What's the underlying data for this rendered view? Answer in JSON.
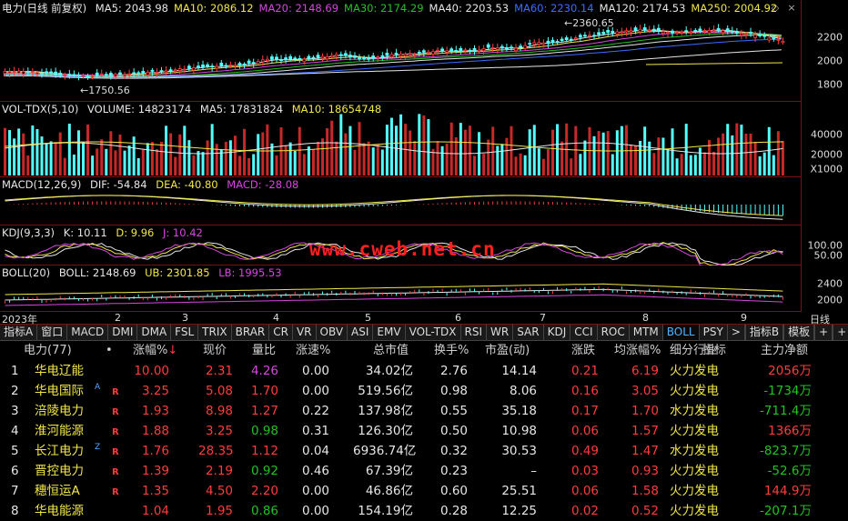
{
  "main_chart": {
    "title": "电力(日线 前复权)",
    "indicators": [
      {
        "label": "MA5: 2043.98",
        "color": "#e6e6e6"
      },
      {
        "label": "MA10: 2086.12",
        "color": "#f2e64a"
      },
      {
        "label": "MA20: 2148.69",
        "color": "#d846e0"
      },
      {
        "label": "MA30: 2174.29",
        "color": "#21c321"
      },
      {
        "label": "MA40: 2203.53",
        "color": "#e6e6e6"
      },
      {
        "label": "MA60: 2230.14",
        "color": "#3c6cff"
      },
      {
        "label": "MA120: 2174.53",
        "color": "#e6e6e6"
      },
      {
        "label": "MA250: 2004.92",
        "color": "#f2e64a"
      }
    ],
    "high_label": "2360.65",
    "low_label": "1750.56",
    "y_ticks": [
      "2200",
      "2000",
      "1800"
    ]
  },
  "vol_chart": {
    "title": "VOL-TDX(5,10)",
    "volume": "VOLUME: 14823174",
    "ma5": "MA5: 17831824",
    "ma10": "MA10: 18654748",
    "y_ticks": [
      "40000",
      "20000"
    ],
    "unit": "X1000"
  },
  "macd_chart": {
    "title": "MACD(12,26,9)",
    "dif": "DIF: -54.84",
    "dea": "DEA: -40.80",
    "macd": "MACD: -28.08"
  },
  "kdj_chart": {
    "title": "KDJ(9,3,3)",
    "k": "K: 10.11",
    "d": "D: 9.96",
    "j": "J: 10.42",
    "y_ticks": [
      "100.00",
      "50.00"
    ]
  },
  "boll_chart": {
    "title": "BOLL(20)",
    "boll": "BOLL: 2148.69",
    "ub": "UB: 2301.85",
    "lb": "LB: 1995.53",
    "y_ticks": [
      "2400",
      "2000"
    ]
  },
  "timebar": {
    "year": "2023年",
    "months": [
      "2",
      "3",
      "4",
      "5",
      "6",
      "7",
      "8",
      "9"
    ],
    "period": "日线"
  },
  "watermark": "www.cweb.net.cn",
  "tabs": [
    "指标A",
    "窗口",
    "MACD",
    "DMI",
    "DMA",
    "FSL",
    "TRIX",
    "BRAR",
    "CR",
    "VR",
    "OBV",
    "ASI",
    "EMV",
    "VOL-TDX",
    "RSI",
    "WR",
    "SAR",
    "KDJ",
    "CCI",
    "ROC",
    "MTM",
    "BOLL",
    "PSY",
    ">"
  ],
  "active_tab": "BOLL",
  "right_tabs": [
    "指标B",
    "模板",
    "+",
    "+"
  ],
  "table": {
    "headers": {
      "name": "电力(77)",
      "dot": "•",
      "pct": "涨幅%",
      "sort_arrow": "↓",
      "price": "现价",
      "vol_ratio": "量比",
      "speed": "涨速%",
      "mcap": "总市值",
      "turnover": "换手%",
      "pe": "市盈(动)",
      "change": "涨跌",
      "avg_pct": "均涨幅%",
      "industry": "细分行业",
      "indicator": "指标",
      "mainflow": "主力净额"
    },
    "rows": [
      {
        "no": "1",
        "name": "华电辽能",
        "sup": "",
        "tag": "",
        "pct": "10.00",
        "price": "2.31",
        "vol_ratio": "4.26",
        "vr_color": "purple",
        "speed": "0.00",
        "mcap": "34.02亿",
        "turnover": "2.76",
        "pe": "14.14",
        "change": "0.21",
        "avg_pct": "6.19",
        "industry": "火力发电",
        "mainflow": "2056万",
        "mf_color": "red"
      },
      {
        "no": "2",
        "name": "华电国际",
        "sup": "A",
        "tag": "R",
        "pct": "3.25",
        "price": "5.08",
        "vol_ratio": "1.70",
        "vr_color": "red",
        "speed": "0.00",
        "mcap": "519.56亿",
        "turnover": "0.98",
        "pe": "8.06",
        "change": "0.16",
        "avg_pct": "3.05",
        "industry": "火力发电",
        "mainflow": "-1734万",
        "mf_color": "green"
      },
      {
        "no": "3",
        "name": "涪陵电力",
        "sup": "",
        "tag": "R",
        "pct": "1.93",
        "price": "8.98",
        "vol_ratio": "1.27",
        "vr_color": "red",
        "speed": "0.22",
        "mcap": "137.98亿",
        "turnover": "0.55",
        "pe": "35.18",
        "change": "0.17",
        "avg_pct": "1.70",
        "industry": "水力发电",
        "mainflow": "-711.4万",
        "mf_color": "green"
      },
      {
        "no": "4",
        "name": "淮河能源",
        "sup": "",
        "tag": "R",
        "pct": "1.88",
        "price": "3.25",
        "vol_ratio": "0.98",
        "vr_color": "green",
        "speed": "0.31",
        "mcap": "126.30亿",
        "turnover": "0.50",
        "pe": "10.98",
        "change": "0.06",
        "avg_pct": "1.57",
        "industry": "火力发电",
        "mainflow": "1366万",
        "mf_color": "red"
      },
      {
        "no": "5",
        "name": "长江电力",
        "sup": "Z",
        "tag": "R",
        "pct": "1.76",
        "price": "28.35",
        "vol_ratio": "1.12",
        "vr_color": "red",
        "speed": "0.04",
        "mcap": "6936.74亿",
        "turnover": "0.32",
        "pe": "30.53",
        "change": "0.49",
        "avg_pct": "1.47",
        "industry": "水力发电",
        "mainflow": "-823.7万",
        "mf_color": "green"
      },
      {
        "no": "6",
        "name": "晋控电力",
        "sup": "",
        "tag": "R",
        "pct": "1.39",
        "price": "2.19",
        "vol_ratio": "0.92",
        "vr_color": "green",
        "speed": "0.46",
        "mcap": "67.39亿",
        "turnover": "0.23",
        "pe": "–",
        "change": "0.03",
        "avg_pct": "0.93",
        "industry": "火力发电",
        "mainflow": "-52.6万",
        "mf_color": "green"
      },
      {
        "no": "7",
        "name": "穗恒运A",
        "sup": "",
        "tag": "R",
        "pct": "1.35",
        "price": "4.50",
        "vol_ratio": "2.20",
        "vr_color": "red",
        "speed": "0.00",
        "mcap": "46.86亿",
        "turnover": "0.60",
        "pe": "25.51",
        "change": "0.06",
        "avg_pct": "1.58",
        "industry": "火力发电",
        "mainflow": "144.9万",
        "mf_color": "red"
      },
      {
        "no": "8",
        "name": "华电能源",
        "sup": "",
        "tag": "",
        "pct": "1.04",
        "price": "1.95",
        "vol_ratio": "0.86",
        "vr_color": "green",
        "speed": "0.00",
        "mcap": "154.19亿",
        "turnover": "0.28",
        "pe": "12.25",
        "change": "0.02",
        "avg_pct": "0.52",
        "industry": "火力发电",
        "mainflow": "-207.1万",
        "mf_color": "green"
      }
    ]
  },
  "colors": {
    "up": "#ff3c3c",
    "down": "#54ffff",
    "frame": "#7a1010",
    "active_tab": "#4fb4ff"
  }
}
